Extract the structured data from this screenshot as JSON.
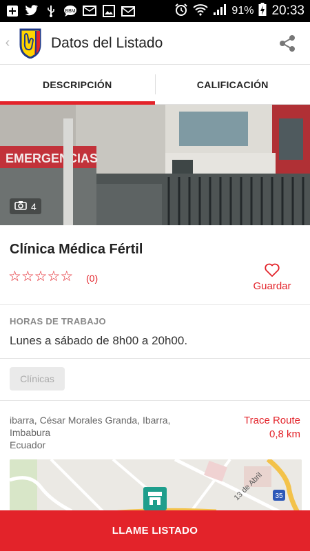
{
  "status_bar": {
    "battery": "91%",
    "time": "20:33"
  },
  "app_bar": {
    "title": "Datos del Listado"
  },
  "tabs": [
    {
      "label": "DESCRIPCIÓN",
      "active": true
    },
    {
      "label": "CALIFICACIÓN",
      "active": false
    }
  ],
  "photo": {
    "sign_text": "EMERGENCIAS",
    "count": "4"
  },
  "listing": {
    "name": "Clínica Médica Fértil",
    "rating_stars": 0,
    "rating_count": "(0)",
    "save_label": "Guardar",
    "hours_label": "HORAS DE TRABAJO",
    "hours_text": "Lunes a sábado de 8h00 a 20h00.",
    "category": "Clínicas",
    "address_line1": "ibarra, César Morales Granda,  Ibarra,",
    "address_line2": "Imbabura",
    "address_line3": "Ecuador",
    "trace_label": "Trace Route",
    "distance": "0,8 km"
  },
  "map": {
    "street_label": "13 de Abril",
    "highway_shield": "35"
  },
  "call_bar": {
    "label": "LLAME LISTADO"
  },
  "colors": {
    "accent": "#e3232a",
    "map_marker": "#1e9e8c"
  },
  "icons": [
    "plus-icon",
    "twitter-icon",
    "usb-icon",
    "chat-icon",
    "messages-icon",
    "image-icon",
    "mail-icon",
    "alarm-icon",
    "wifi-icon",
    "signal-icon",
    "battery-icon",
    "back-chevron-icon",
    "share-icon",
    "camera-icon",
    "star-outline-icon",
    "heart-outline-icon",
    "store-marker-icon"
  ]
}
